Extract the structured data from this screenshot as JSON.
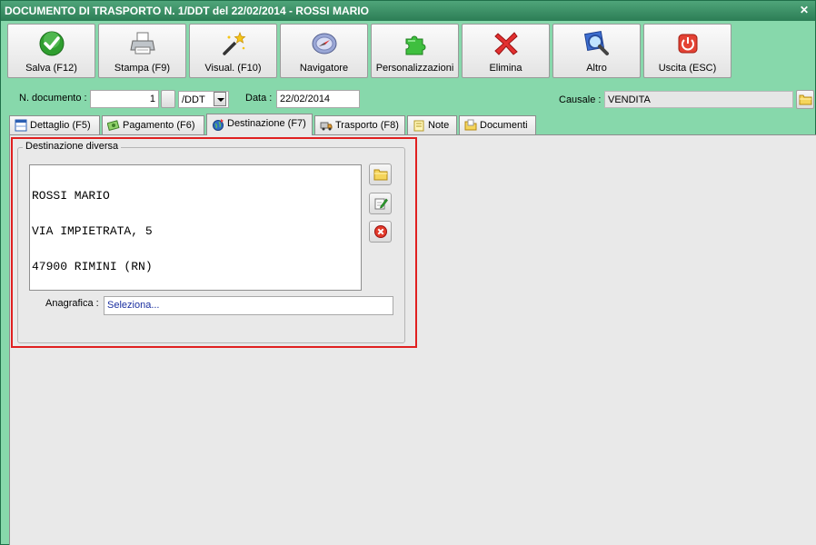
{
  "window": {
    "title": "DOCUMENTO DI TRASPORTO N. 1/DDT del 22/02/2014 - ROSSI MARIO",
    "close_glyph": "✕"
  },
  "toolbar": {
    "buttons": [
      {
        "label": "Salva (F12)",
        "icon": "checkmark-icon"
      },
      {
        "label": "Stampa (F9)",
        "icon": "printer-icon"
      },
      {
        "label": "Visual. (F10)",
        "icon": "magic-wand-icon"
      },
      {
        "label": "Navigatore",
        "icon": "compass-icon"
      },
      {
        "label": "Personalizzazioni",
        "icon": "puzzle-icon"
      },
      {
        "label": "Elimina",
        "icon": "red-x-icon"
      },
      {
        "label": "Altro",
        "icon": "magnifier-icon"
      },
      {
        "label": "Uscita (ESC)",
        "icon": "power-icon"
      }
    ]
  },
  "header": {
    "doc_number_label": "N. documento :",
    "doc_number_value": "1",
    "series_value": "/DDT",
    "date_label": "Data :",
    "date_value": "22/02/2014",
    "causale_label": "Causale :",
    "causale_value": "VENDITA"
  },
  "tabs": [
    {
      "label": "Dettaglio (F5)",
      "icon": "table-icon",
      "active": false
    },
    {
      "label": "Pagamento (F6)",
      "icon": "money-icon",
      "active": false
    },
    {
      "label": "Destinazione (F7)",
      "icon": "globe-icon",
      "active": true
    },
    {
      "label": "Trasporto (F8)",
      "icon": "truck-icon",
      "active": false
    },
    {
      "label": "Note",
      "icon": "note-icon",
      "active": false
    },
    {
      "label": "Documenti",
      "icon": "folder-icon",
      "active": false
    }
  ],
  "destination": {
    "group_title": "Destinazione diversa",
    "address_lines": [
      "ROSSI MARIO",
      "VIA IMPIETRATA, 5",
      "47900 RIMINI (RN)"
    ],
    "anagrafica_label": "Anagrafica :",
    "anagrafica_value": "Seleziona..."
  },
  "colors": {
    "window_bg": "#87d8ab",
    "highlight_border": "#e02020",
    "link_blue": "#1a2fa0"
  }
}
